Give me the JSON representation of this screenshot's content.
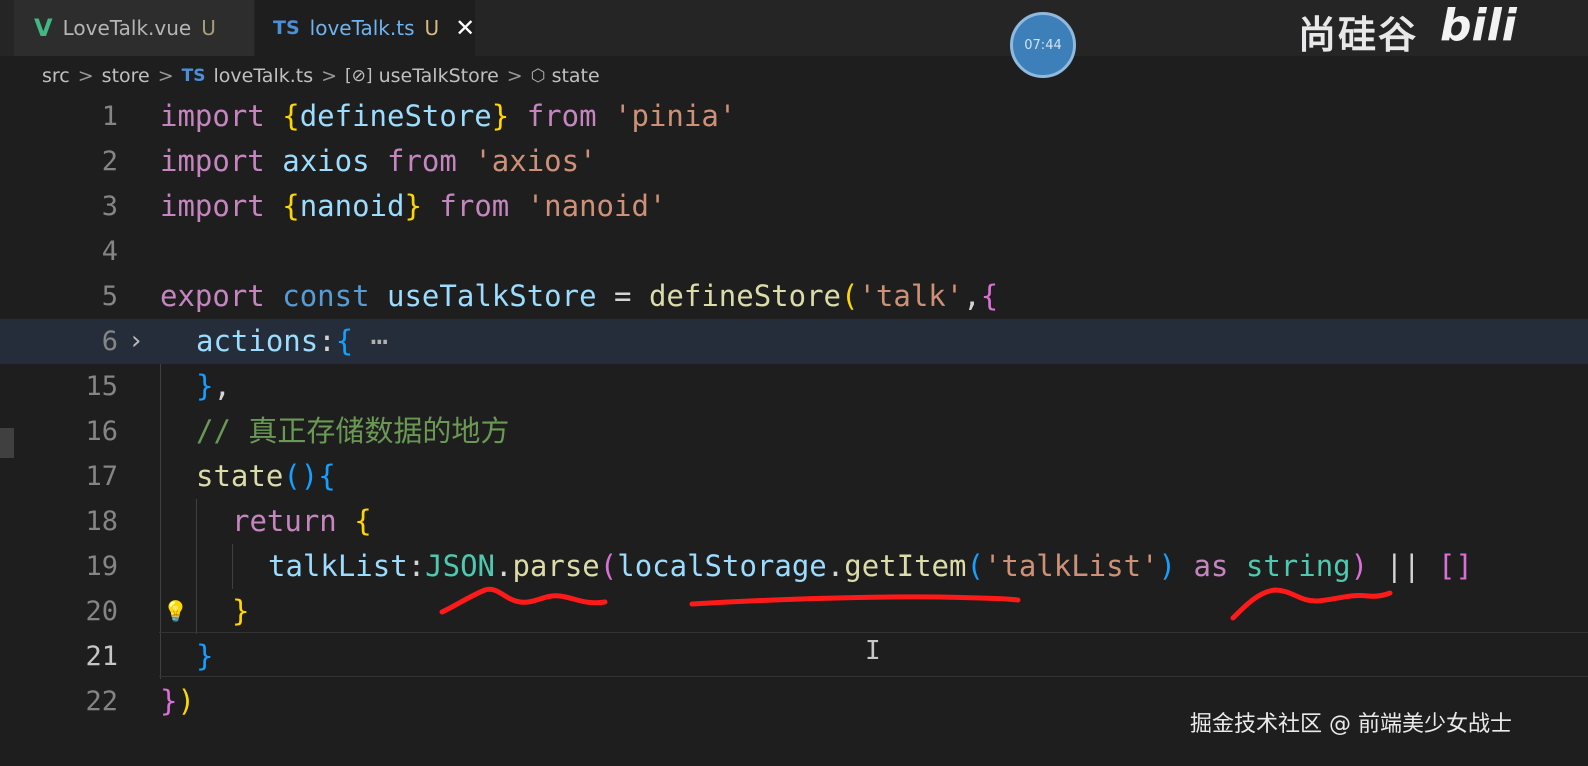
{
  "tabs": [
    {
      "icon": "vue-icon",
      "label": "LoveTalk.vue",
      "status": "U"
    },
    {
      "icon": "ts-icon",
      "icon_text": "TS",
      "label": "loveTalk.ts",
      "status": "U",
      "close": "✕"
    }
  ],
  "watermark": {
    "cn": "尚硅谷",
    "bili": "bili"
  },
  "timer": "07:44",
  "breadcrumb": {
    "src": "src",
    "store": "store",
    "ts_icon": "TS",
    "file": "loveTalk.ts",
    "var_icon": "[⊘]",
    "store_fn": "useTalkStore",
    "prop_icon": "⬡",
    "prop": "state",
    "sep": ">"
  },
  "gutter": {
    "line_numbers": [
      "1",
      "2",
      "3",
      "4",
      "5",
      "6",
      "15",
      "16",
      "17",
      "18",
      "19",
      "20",
      "21",
      "22"
    ]
  },
  "code": {
    "l1": {
      "kw": "import",
      "ob": "{",
      "name": "defineStore",
      "cb": "}",
      "from": "from",
      "str": "'pinia'"
    },
    "l2": {
      "kw": "import",
      "name": "axios",
      "from": "from",
      "str": "'axios'"
    },
    "l3": {
      "kw": "import",
      "ob": "{",
      "name": "nanoid",
      "cb": "}",
      "from": "from",
      "str": "'nanoid'"
    },
    "l5": {
      "kw": "export",
      "const": "const",
      "name": "useTalkStore",
      "eq": "=",
      "fn": "defineStore",
      "op": "(",
      "str": "'talk'",
      "comma": ",",
      "ob": "{"
    },
    "l6": {
      "key": "actions",
      "colon": ":",
      "ob": "{",
      "dots": "⋯"
    },
    "l15": {
      "cb": "}",
      "comma": ","
    },
    "l16": {
      "comment": "// 真正存储数据的地方"
    },
    "l17": {
      "fn": "state",
      "parens": "()",
      "ob": "{"
    },
    "l18": {
      "kw": "return",
      "ob": "{"
    },
    "l19": {
      "key": "talkList",
      "colon": ":",
      "json": "JSON",
      "dot1": ".",
      "parse": "parse",
      "op": "(",
      "ls": "localStorage",
      "dot2": ".",
      "get": "getItem",
      "op2": "(",
      "str": "'talkList'",
      "cp2": ")",
      "as": "as",
      "type": "string",
      "cp": ")",
      "or": "||",
      "arr": "[]"
    },
    "l20": {
      "cb": "}"
    },
    "l21": {
      "cb": "}"
    },
    "l22": {
      "cb": "}",
      "cp": ")"
    }
  },
  "credit": "掘金技术社区 @ 前端美少女战士",
  "colors": {
    "keyword": "#c586c0",
    "string": "#ce9178",
    "variable": "#9cdcfe",
    "function": "#dcdcaa",
    "comment": "#6a9955",
    "underline": "#ff1a1a"
  }
}
